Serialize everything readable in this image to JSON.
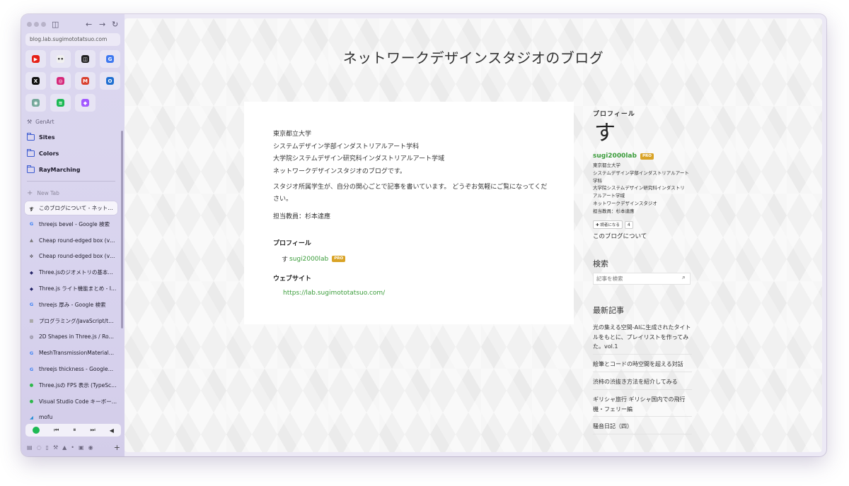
{
  "browser": {
    "url": "blog.lab.sugimototatsuo.com",
    "colors": {
      "sidebar_bg": "#dcd8ef",
      "accent_green": "#3a9c3a",
      "folder_blue": "#3a5ad0",
      "pro_badge": "#d9a326"
    },
    "favorites": [
      {
        "name": "youtube",
        "color": "#e62117",
        "glyph": "▶"
      },
      {
        "name": "eyes",
        "color": "#f0f0f0",
        "glyph": "••"
      },
      {
        "name": "notion",
        "color": "#222222",
        "glyph": "◫"
      },
      {
        "name": "google",
        "color": "#3e79f0",
        "glyph": "G"
      },
      {
        "name": "x",
        "color": "#111111",
        "glyph": "X"
      },
      {
        "name": "instagram",
        "color": "#d6287a",
        "glyph": "◎"
      },
      {
        "name": "gmail",
        "color": "#d9412f",
        "glyph": "M"
      },
      {
        "name": "outlook",
        "color": "#1f6fd1",
        "glyph": "O"
      },
      {
        "name": "chatgpt",
        "color": "#74a79a",
        "glyph": "◉"
      },
      {
        "name": "spotify",
        "color": "#1db954",
        "glyph": "≋"
      },
      {
        "name": "figma",
        "color": "#a259ff",
        "glyph": "◆"
      }
    ],
    "section_label": "GenArt",
    "folders": [
      "Sites",
      "Colors",
      "RayMarching"
    ],
    "new_tab_label": "New Tab",
    "tabs": [
      {
        "title": "このブログについて - ネット…",
        "icon": "す",
        "icon_color": "#222222",
        "active": true
      },
      {
        "title": "threejs bevel - Google 検索",
        "icon": "G",
        "icon_color": "#4285f4"
      },
      {
        "title": "Cheap round-edged box (v…",
        "icon": "▲",
        "icon_color": "#777777"
      },
      {
        "title": "Cheap round-edged box (v…",
        "icon": "✲",
        "icon_color": "#333333"
      },
      {
        "title": "Three.jsのジオメトリの基本…",
        "icon": "◆",
        "icon_color": "#222266"
      },
      {
        "title": "Three.js ライト機能まとめ - I…",
        "icon": "◆",
        "icon_color": "#222266"
      },
      {
        "title": "threejs 厚み - Google 検索",
        "icon": "G",
        "icon_color": "#4285f4"
      },
      {
        "title": "プログラミング/JavaScript/t…",
        "icon": "■",
        "icon_color": "#aaaaaa"
      },
      {
        "title": "2D Shapes in Three.js / Ro…",
        "icon": "◎",
        "icon_color": "#444444"
      },
      {
        "title": "MeshTransmissionMaterial…",
        "icon": "G",
        "icon_color": "#4285f4"
      },
      {
        "title": "threejs thickness - Google…",
        "icon": "G",
        "icon_color": "#4285f4"
      },
      {
        "title": "Three.jsの FPS 表示 (TypeSc…",
        "icon": "●",
        "icon_color": "#2db84a"
      },
      {
        "title": "Visual Studio Code キーボー…",
        "icon": "●",
        "icon_color": "#2db84a"
      },
      {
        "title": "mofu",
        "icon": "◢",
        "icon_color": "#2a8fd6"
      }
    ],
    "player_controls": [
      "prev",
      "pause",
      "next",
      "volume"
    ]
  },
  "blog": {
    "title": "ネットワークデザインスタジオのブログ",
    "article": {
      "intro_lines": [
        "東京都立大学",
        "システムデザイン学部インダストリアルアート学科",
        "大学院システムデザイン研究科インダストリアルアート学域",
        "ネットワークデザインスタジオのブログです。"
      ],
      "paragraph": "スタジオ所属学生が、自分の関心ごとで記事を書いています。 どうぞお気軽にご覧になってください。",
      "teacher": "担当教員：杉本達應",
      "profile_heading": "プロフィール",
      "user": "sugi2000lab",
      "pro_badge": "PRO",
      "website_heading": "ウェブサイト",
      "website_url": "https://lab.sugimototatsuo.com/"
    },
    "sidebar": {
      "profile_heading": "プロフィール",
      "avatar_char": "す",
      "user": "sugi2000lab",
      "pro_badge": "PRO",
      "bio_lines": [
        "東京都立大学",
        "システムデザイン学部インダストリアルアート",
        "学科",
        "大学院システムデザイン研究科インダストリ",
        "アルアート学域",
        "ネットワークデザインスタジオ",
        "担当教員：杉本達應"
      ],
      "reader_button": "✚ 読者になる",
      "reader_count": "4",
      "about_link": "このブログについて",
      "search_heading": "検索",
      "search_placeholder": "記事を検索",
      "recent_heading": "最新記事",
      "recent_posts": [
        "光の集える空間-AIに生成されたタイトルをもとに、プレイリストを作ってみた。vol.1",
        "絵筆とコードの時空間を超える対話",
        "渋柿の渋抜き方法を紹介してみる",
        "ギリシャ旅行 ギリシャ国内での飛行機・フェリー編",
        "騒音日記（四）"
      ]
    }
  }
}
